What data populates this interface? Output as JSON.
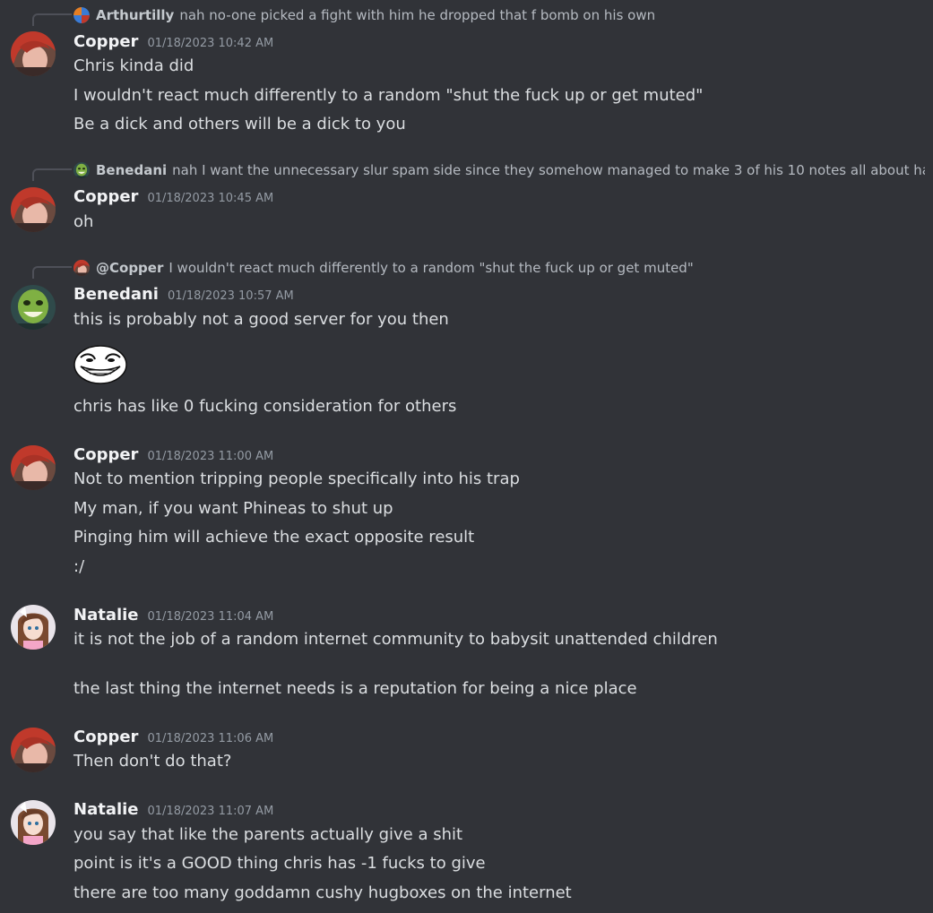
{
  "messages": [
    {
      "reply": {
        "name": "Arthurtilly",
        "text": "nah no-one picked a fight with him he dropped that f bomb on his own"
      },
      "author": "Copper",
      "time": "01/18/2023 10:42 AM",
      "lines": [
        "Chris kinda did",
        "I wouldn't react much differently to a random \"shut the fuck up or get muted\"",
        "Be a dick and others will be a dick to you"
      ]
    },
    {
      "reply": {
        "name": "Benedani",
        "text": "nah I want the unnecessary slur spam side since they somehow managed to make 3 of his 10 notes all about hating"
      },
      "author": "Copper",
      "time": "01/18/2023 10:45 AM",
      "lines": [
        "oh"
      ]
    },
    {
      "reply": {
        "name": "@Copper",
        "text": "I wouldn't react much differently to a random \"shut the fuck up or get muted\""
      },
      "author": "Benedani",
      "time": "01/18/2023 10:57 AM",
      "lines": [
        "this is probably not a good server for you then",
        "chris has like 0 fucking consideration for others"
      ],
      "emoji": "trollface-emoji"
    },
    {
      "author": "Copper",
      "time": "01/18/2023 11:00 AM",
      "lines": [
        "Not to mention tripping people specifically into his trap",
        "My man, if you want Phineas to shut up",
        "Pinging him will achieve the exact opposite result",
        ":/"
      ]
    },
    {
      "author": "Natalie",
      "time": "01/18/2023 11:04 AM",
      "lines": [
        "it is not the job of a random internet community to babysit unattended children",
        "the last thing the internet needs is a reputation for being a nice place"
      ]
    },
    {
      "author": "Copper",
      "time": "01/18/2023 11:06 AM",
      "lines": [
        "Then don't do that?"
      ]
    },
    {
      "author": "Natalie",
      "time": "01/18/2023 11:07 AM",
      "lines": [
        "you say that like the parents actually give a shit",
        "point is it's a GOOD thing chris has -1 fucks to give",
        "there are too many goddamn cushy hugboxes on the internet"
      ]
    }
  ],
  "colors": {
    "background": "#313338",
    "username": "#f2f3f5",
    "timestamp": "#949ba4",
    "text": "#dbdee1"
  }
}
